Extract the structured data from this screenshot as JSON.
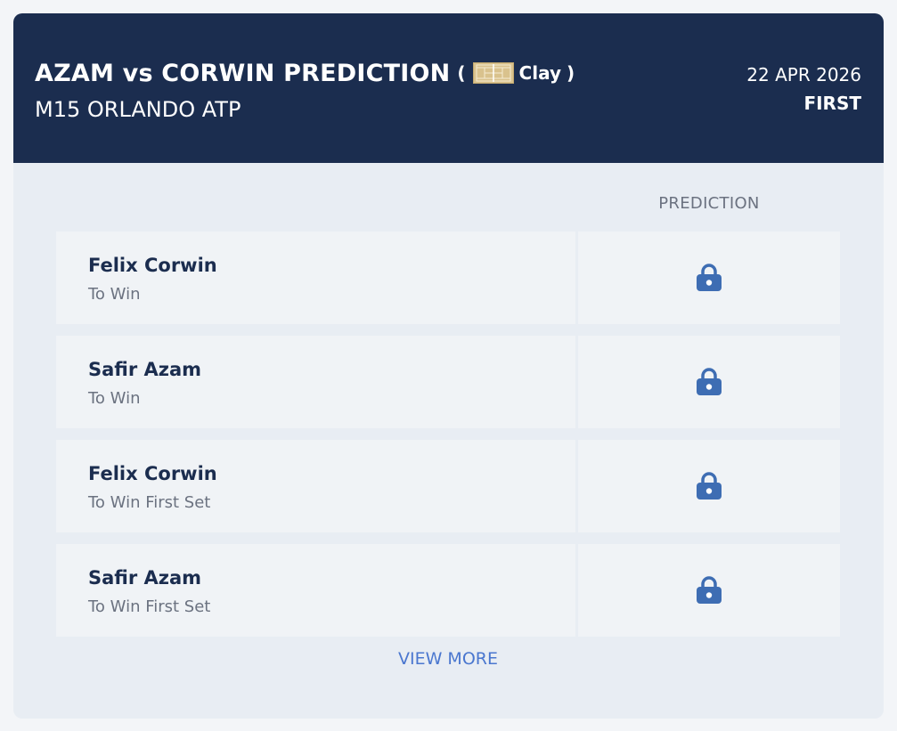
{
  "header": {
    "title": "AZAM vs CORWIN PREDICTION",
    "paren_open": "(",
    "surface_icon": "clay-court-icon",
    "surface": "Clay",
    "paren_close": ")",
    "tournament": "M15 ORLANDO ATP",
    "date": "22 APR 2026",
    "round": "FIRST"
  },
  "table": {
    "column_header": "PREDICTION",
    "rows": [
      {
        "player": "Felix Corwin",
        "market": "To Win",
        "prediction_icon": "lock-icon"
      },
      {
        "player": "Safir Azam",
        "market": "To Win",
        "prediction_icon": "lock-icon"
      },
      {
        "player": "Felix Corwin",
        "market": "To Win First Set",
        "prediction_icon": "lock-icon"
      },
      {
        "player": "Safir Azam",
        "market": "To Win First Set",
        "prediction_icon": "lock-icon"
      }
    ]
  },
  "footer": {
    "view_more_label": "VIEW MORE"
  },
  "colors": {
    "header_bg": "#1b2d4f",
    "card_bg": "#e8edf3",
    "row_bg": "#f0f3f6",
    "lock_color": "#3e6db3",
    "link_color": "#4a77cf",
    "court_color": "#d9c28d"
  }
}
